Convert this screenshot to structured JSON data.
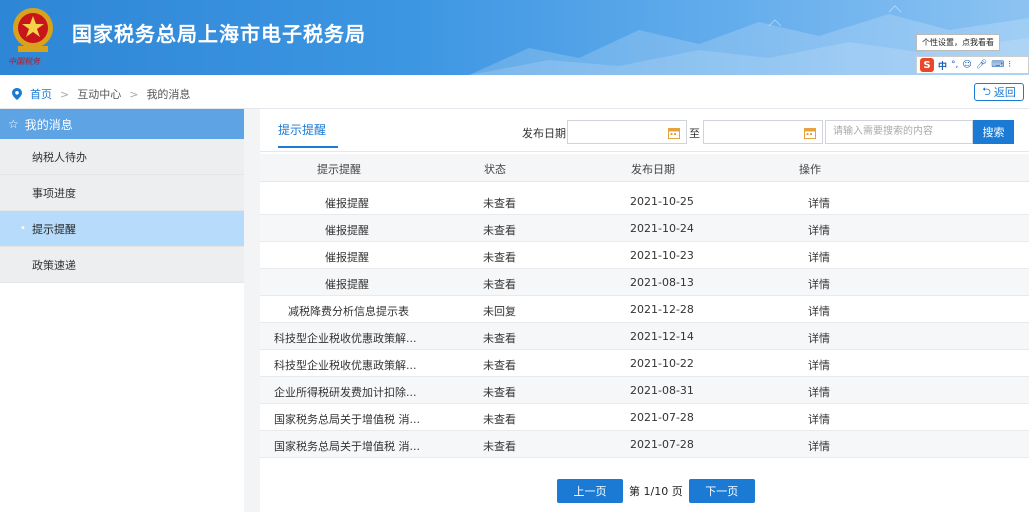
{
  "header": {
    "site_title": "国家税务总局上海市电子税务局",
    "emblem_caption": "中国税务"
  },
  "ime": {
    "tooltip": "个性设置，点我看看",
    "mode": "中",
    "logo": "S"
  },
  "breadcrumb": {
    "home": "首页",
    "level1": "互动中心",
    "level2": "我的消息",
    "back_label": "返回"
  },
  "sidebar": {
    "title": "我的消息",
    "items": [
      {
        "label": "纳税人待办"
      },
      {
        "label": "事项进度"
      },
      {
        "label": "提示提醒"
      },
      {
        "label": "政策速递"
      }
    ]
  },
  "panel": {
    "tab_label": "提示提醒",
    "filter": {
      "date_label": "发布日期",
      "to_label": "至",
      "search_placeholder": "请输入需要搜索的内容",
      "search_button": "搜索"
    },
    "table": {
      "headers": [
        "提示提醒",
        "状态",
        "发布日期",
        "操作"
      ],
      "rows": [
        {
          "title": "催报提醒",
          "status": "未查看",
          "date": "2021-10-25",
          "action": "详情"
        },
        {
          "title": "催报提醒",
          "status": "未查看",
          "date": "2021-10-24",
          "action": "详情"
        },
        {
          "title": "催报提醒",
          "status": "未查看",
          "date": "2021-10-23",
          "action": "详情"
        },
        {
          "title": "催报提醒",
          "status": "未查看",
          "date": "2021-08-13",
          "action": "详情"
        },
        {
          "title": "减税降费分析信息提示表",
          "status": "未回复",
          "date": "2021-12-28",
          "action": "详情"
        },
        {
          "title": "科技型企业税收优惠政策解...",
          "status": "未查看",
          "date": "2021-12-14",
          "action": "详情"
        },
        {
          "title": "科技型企业税收优惠政策解...",
          "status": "未查看",
          "date": "2021-10-22",
          "action": "详情"
        },
        {
          "title": "企业所得税研发费加计扣除...",
          "status": "未查看",
          "date": "2021-08-31",
          "action": "详情"
        },
        {
          "title": "国家税务总局关于增值税 消...",
          "status": "未查看",
          "date": "2021-07-28",
          "action": "详情"
        },
        {
          "title": "国家税务总局关于增值税 消...",
          "status": "未查看",
          "date": "2021-07-28",
          "action": "详情"
        }
      ]
    },
    "pager": {
      "prev": "上一页",
      "info": "第 1/10 页",
      "next": "下一页"
    }
  },
  "colors": {
    "primary": "#1b7ad4",
    "sidebar_head": "#5ea3e4",
    "sidebar_active": "#b7dcfb"
  }
}
